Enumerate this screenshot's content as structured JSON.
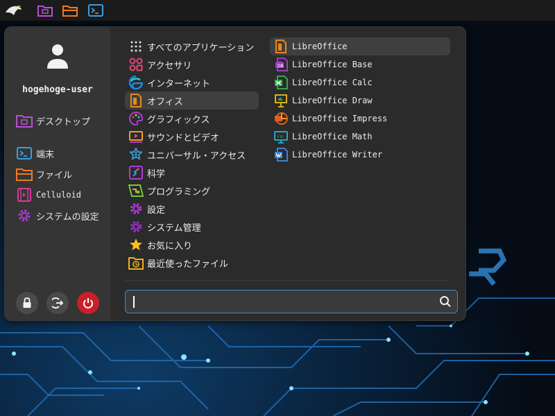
{
  "panel": {
    "launchers": [
      {
        "icon": "eagle-logo-icon"
      },
      {
        "icon": "desktop-folder-icon"
      },
      {
        "icon": "folder-icon"
      },
      {
        "icon": "terminal-icon"
      }
    ]
  },
  "sidebar": {
    "username": "hogehoge-user",
    "places": [
      {
        "label": "デスクトップ",
        "icon": "desktop-folder-icon"
      }
    ],
    "favorites": [
      {
        "label": "端末",
        "icon": "terminal-icon"
      },
      {
        "label": "ファイル",
        "icon": "folder-icon"
      },
      {
        "label": "Celluloid",
        "icon": "video-player-icon"
      },
      {
        "label": "システムの設定",
        "icon": "settings-gear-icon"
      }
    ],
    "actions": [
      {
        "icon": "lock-icon"
      },
      {
        "icon": "logout-icon"
      },
      {
        "icon": "power-icon"
      }
    ]
  },
  "categories": [
    {
      "label": "すべてのアプリケーション",
      "icon": "grid-icon"
    },
    {
      "label": "アクセサリ",
      "icon": "accessories-icon"
    },
    {
      "label": "インターネット",
      "icon": "internet-icon"
    },
    {
      "label": "オフィス",
      "icon": "office-icon",
      "selected": true
    },
    {
      "label": "グラフィックス",
      "icon": "palette-icon"
    },
    {
      "label": "サウンドとビデオ",
      "icon": "multimedia-icon"
    },
    {
      "label": "ユニバーサル・アクセス",
      "icon": "accessibility-icon"
    },
    {
      "label": "科学",
      "icon": "science-icon"
    },
    {
      "label": "プログラミング",
      "icon": "programming-icon"
    },
    {
      "label": "設定",
      "icon": "settings-gear-icon"
    },
    {
      "label": "システム管理",
      "icon": "system-gear-icon"
    },
    {
      "label": "お気に入り",
      "icon": "star-icon"
    },
    {
      "label": "最近使ったファイル",
      "icon": "recent-folder-icon"
    }
  ],
  "apps": [
    {
      "label": "LibreOffice",
      "icon": "libreoffice-icon",
      "color": "#e8891c",
      "selected": true
    },
    {
      "label": "LibreOffice Base",
      "icon": "libreoffice-base-icon",
      "color": "#a03cc8"
    },
    {
      "label": "LibreOffice Calc",
      "icon": "libreoffice-calc-icon",
      "color": "#2fa84f"
    },
    {
      "label": "LibreOffice Draw",
      "icon": "libreoffice-draw-icon",
      "color": "#d8b21a"
    },
    {
      "label": "LibreOffice Impress",
      "icon": "libreoffice-impress-icon",
      "color": "#e55a1e"
    },
    {
      "label": "LibreOffice Math",
      "icon": "libreoffice-math-icon",
      "color": "#2aa4c4"
    },
    {
      "label": "LibreOffice Writer",
      "icon": "libreoffice-writer-icon",
      "color": "#3f7fd8"
    }
  ],
  "search": {
    "value": "",
    "placeholder": ""
  },
  "colors": {
    "accent": "#3b8bd4",
    "power": "#c8202a",
    "menu_bg": "#2b2b2b",
    "sidebar_bg": "#353535",
    "panel_bg": "#1b1b1b"
  }
}
